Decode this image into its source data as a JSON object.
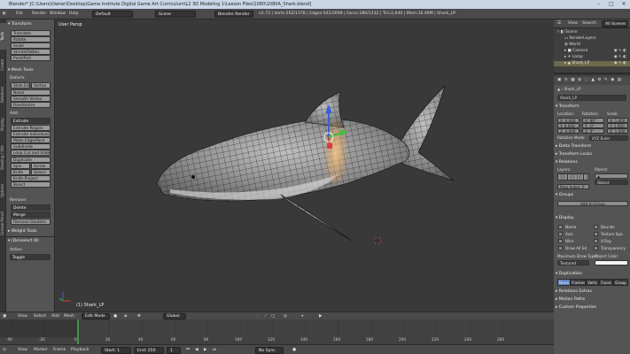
{
  "title_bar": {
    "title": "Blender* [C:\\Users\\Owner\\Desktop\\Game Institute Digital Game Art Curriculum\\L2 3D Modeling 1\\Lesson Files\\1080\\1080A_Shark.blend]"
  },
  "info_header": {
    "menus": [
      "File",
      "Render",
      "Window",
      "Help"
    ],
    "screen": "Default",
    "scene": "Scene",
    "engine": "Blender Render",
    "stats": "v2.73 | Verts:262/1378 | Edges:542/2698 | Faces:280/1332 | Tris:2,640 | Mem:16.49M | Shark_LP"
  },
  "tool_shelf": {
    "tabs": [
      "Tools",
      "Create",
      "Relations",
      "Display",
      "Shading / UVs",
      "Options",
      "Grease Pencil"
    ],
    "transform_header": "Transform",
    "transform": [
      "Translate",
      "Rotate",
      "Scale",
      "Shrink/Fatten",
      "Push/Pull"
    ],
    "mesh_tools_header": "Mesh Tools",
    "deform_label": "Deform:",
    "deform_row": [
      "Slide Ed",
      "Vertex"
    ],
    "deform": [
      "Noise",
      "Smooth Vertex",
      "Randomize"
    ],
    "add_label": "Add:",
    "extrude_btn": "Extrude",
    "add": [
      "Extrude Region",
      "Extrude Individual",
      "Make Edge/Face",
      "Subdivide",
      "Loop Cut and Slide",
      "Duplicate"
    ],
    "spin_row": [
      "Spin",
      "Screw"
    ],
    "knife_row": [
      "Knife",
      "Select"
    ],
    "add_more": [
      "Knife Project",
      "Bisect"
    ],
    "remove_label": "Remove:",
    "remove": [
      "Delete",
      "Merge",
      "Remove Doubles"
    ],
    "weight_tools": "Weight Tools",
    "deselect_all": "(De)select All",
    "action_label": "Action",
    "action_value": "Toggle"
  },
  "viewport": {
    "mode_label": "User Persp",
    "object_label": "(1) Shark_LP"
  },
  "view_header": {
    "menus": [
      "View",
      "Select",
      "Add",
      "Mesh"
    ],
    "mode": "Edit Mode",
    "pivot": "Global"
  },
  "timeline": {
    "ticks": [
      "-40",
      "-20",
      "0",
      "20",
      "40",
      "60",
      "80",
      "100",
      "120",
      "140",
      "160",
      "180",
      "200",
      "220",
      "240",
      "260"
    ],
    "menus": [
      "View",
      "Marker",
      "Frame",
      "Playback"
    ],
    "start": "Start:",
    "start_val": "1",
    "end": "End:",
    "end_val": "250",
    "current": "1",
    "sync": "No Sync"
  },
  "outliner": {
    "menus": [
      "View",
      "Search",
      "All Scenes"
    ],
    "items": [
      "Scene",
      "RenderLayers",
      "World",
      "Camera",
      "Lamp",
      "Shark_LP"
    ]
  },
  "properties": {
    "object_path": "Shark_LP",
    "name": "Shark_LP",
    "transform": "Transform",
    "loc_label": "Location:",
    "rot_label": "Rotation:",
    "scale_label": "Scale:",
    "loc": [
      "X: 0.000",
      "Y: 0.000",
      "Z: 0.000"
    ],
    "rot": [
      "X: 90°",
      "Y: -0°",
      "Z: 0°"
    ],
    "scale": [
      "X: 1.000",
      "Y: 1.000",
      "Z: 1.000"
    ],
    "rotation_mode_label": "Rotation Mode:",
    "rotation_mode": "XYZ Euler",
    "delta_transform": "Delta Transform",
    "transform_locks": "Transform Locks",
    "relations": "Relations",
    "layers_label": "Layers:",
    "parent_label": "Parent:",
    "object_field": "Object",
    "pass_index": "Pass Index: 0",
    "groups": "Groups",
    "add_to_group": "Add to Group",
    "display": "Display",
    "display_checks_left": [
      "Name",
      "Axis",
      "Wire",
      "Draw All Ed"
    ],
    "display_checks_right": [
      "Bounds",
      "Texture Spa",
      "X-Ray",
      "Transparency"
    ],
    "max_draw_label": "Maximum Draw Type:",
    "max_draw": "Textured",
    "obj_color_label": "Object Color:",
    "duplication": "Duplication",
    "dup_tabs": [
      "None",
      "Frames",
      "Verts",
      "Faces",
      "Group"
    ],
    "relations_extras": "Relations Extras",
    "motion_paths": "Motion Paths",
    "custom_properties": "Custom Properties"
  },
  "colors": {
    "accent": "#5b82c4",
    "selected_row": "#6c6a4a",
    "title_bar": "#c9d6e6"
  }
}
